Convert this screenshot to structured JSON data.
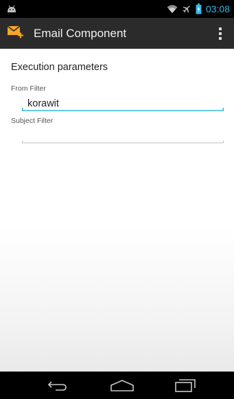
{
  "status_bar": {
    "notification_icon": "android-icon",
    "wifi_icon": "wifi-icon",
    "airplane_icon": "airplane-icon",
    "battery_icon": "battery-charging-icon",
    "time": "03:08",
    "time_color": "#33b5e5"
  },
  "action_bar": {
    "app_icon": "email-add-icon",
    "title": "Email Component",
    "overflow_icon": "overflow-menu-icon",
    "accent_color": "#f5a623",
    "background_color": "#2b2b2b"
  },
  "form": {
    "section_title": "Execution parameters",
    "from_filter": {
      "label": "From Filter",
      "value": "korawit",
      "focused": true,
      "underline_color": "#33b5e5"
    },
    "subject_filter": {
      "label": "Subject Filter",
      "value": "",
      "focused": false,
      "underline_color": "#bdbdbd"
    }
  },
  "nav_bar": {
    "back_icon": "back-icon",
    "home_icon": "home-icon",
    "recent_icon": "recent-apps-icon"
  }
}
